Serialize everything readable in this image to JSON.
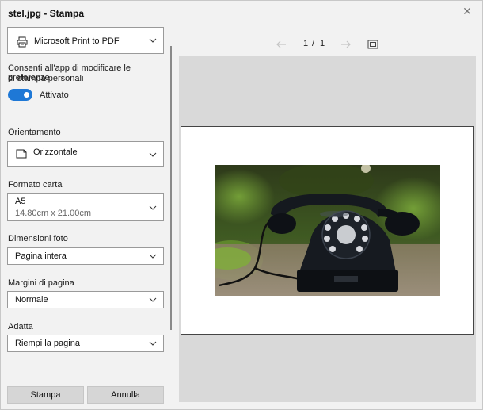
{
  "window": {
    "title": "stel.jpg - Stampa"
  },
  "printer": {
    "selected": "Microsoft Print to PDF"
  },
  "permission": {
    "text_line1": "Consenti all'app di modificare le preferenze",
    "text_line2": "di stampa personali",
    "toggle_label": "Attivato",
    "toggle_on": true
  },
  "orientation": {
    "label": "Orientamento",
    "selected": "Orizzontale"
  },
  "paper_size": {
    "label": "Formato carta",
    "selected": "A5",
    "detail": "14.80cm x 21.00cm"
  },
  "photo_size": {
    "label": "Dimensioni foto",
    "selected": "Pagina intera"
  },
  "margins": {
    "label": "Margini di pagina",
    "selected": "Normale"
  },
  "fit": {
    "label": "Adatta",
    "selected": "Riempi la pagina"
  },
  "footer": {
    "print_label": "Stampa",
    "cancel_label": "Annulla"
  },
  "pager": {
    "current": "1",
    "separator": "/",
    "total": "1"
  },
  "colors": {
    "accent": "#1e78d6",
    "preview_bg": "#d9d9d9",
    "panel_bg": "#f2f2f2"
  }
}
